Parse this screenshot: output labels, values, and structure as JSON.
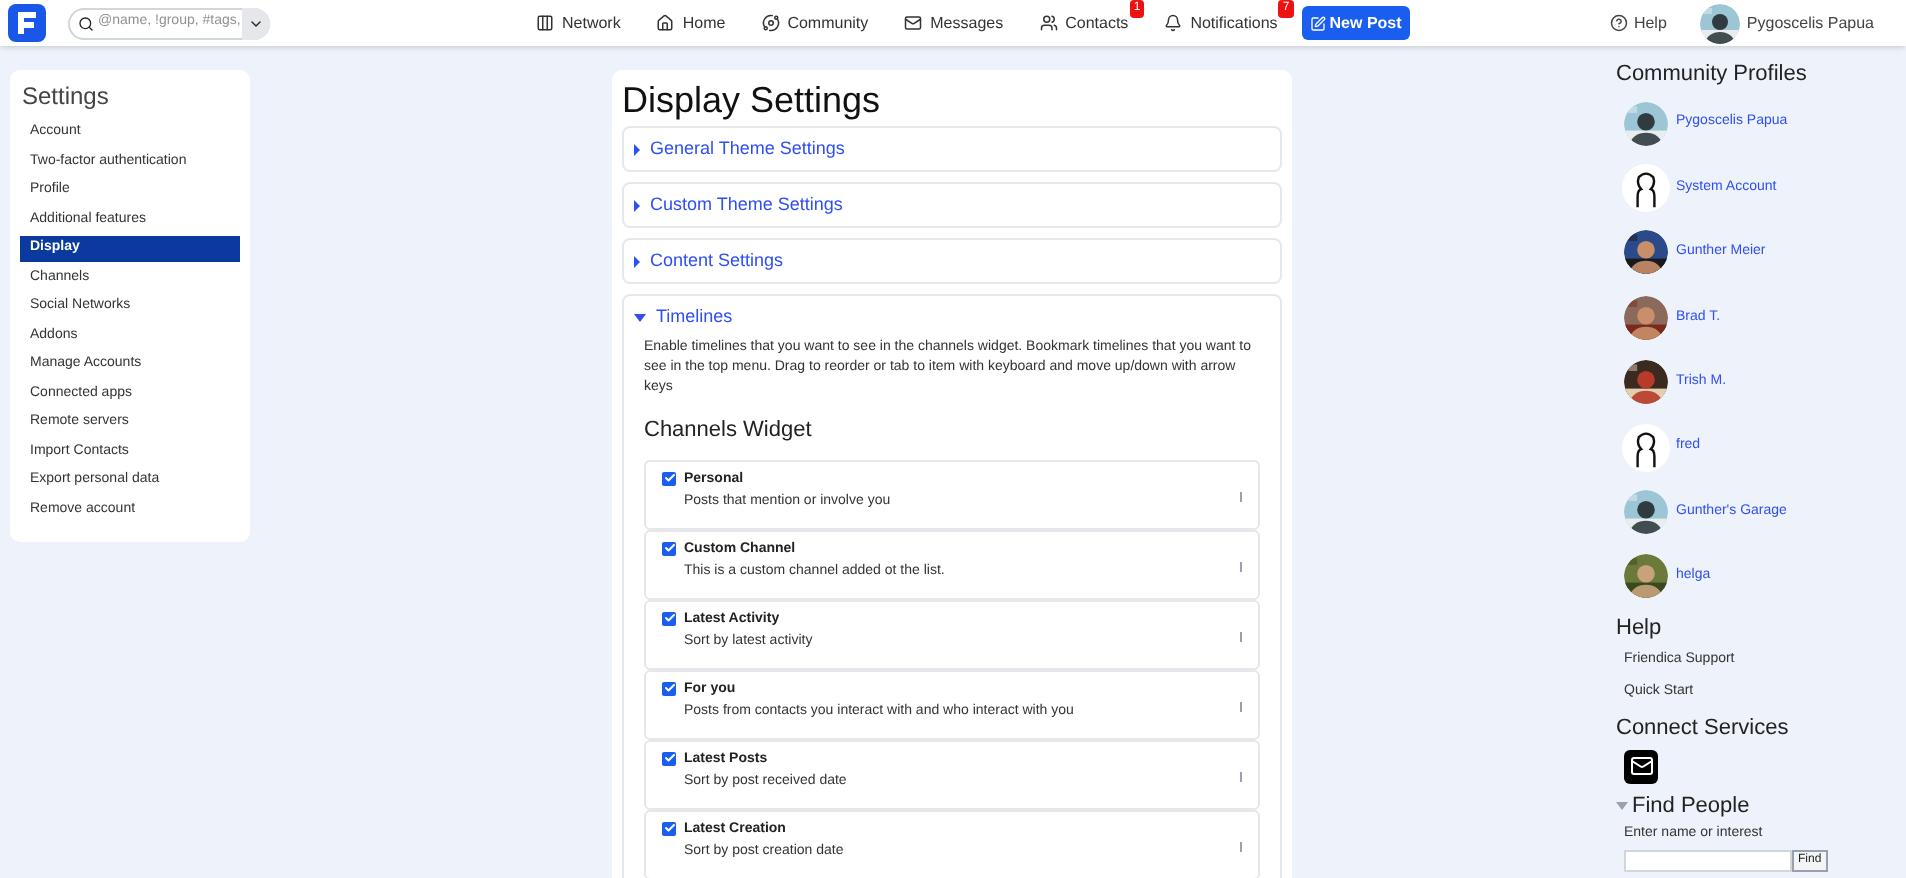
{
  "topbar": {
    "search": {
      "placeholder": "@name, !group, #tags,"
    },
    "nav": [
      {
        "label": "Network"
      },
      {
        "label": "Home"
      },
      {
        "label": "Community"
      },
      {
        "label": "Messages"
      },
      {
        "label": "Contacts",
        "badge": "1"
      },
      {
        "label": "Notifications",
        "badge": "7"
      }
    ],
    "new_post": "New Post",
    "help": "Help",
    "user": "Pygoscelis Papua"
  },
  "sidebar": {
    "title": "Settings",
    "items": [
      {
        "label": "Account",
        "selected": false
      },
      {
        "label": "Two-factor authentication",
        "selected": false
      },
      {
        "label": "Profile",
        "selected": false
      },
      {
        "label": "Additional features",
        "selected": false
      },
      {
        "label": "Display",
        "selected": true
      },
      {
        "label": "Channels",
        "selected": false
      },
      {
        "label": "Social Networks",
        "selected": false
      },
      {
        "label": "Addons",
        "selected": false
      },
      {
        "label": "Manage Accounts",
        "selected": false
      },
      {
        "label": "Connected apps",
        "selected": false
      },
      {
        "label": "Remote servers",
        "selected": false
      },
      {
        "label": "Import Contacts",
        "selected": false
      },
      {
        "label": "Export personal data",
        "selected": false
      },
      {
        "label": "Remove account",
        "selected": false
      }
    ]
  },
  "main": {
    "title": "Display Settings",
    "sections": [
      {
        "label": "General Theme Settings",
        "expanded": false
      },
      {
        "label": "Custom Theme Settings",
        "expanded": false
      },
      {
        "label": "Content Settings",
        "expanded": false
      },
      {
        "label": "Timelines",
        "expanded": true
      }
    ],
    "intro": "Enable timelines that you want to see in the channels widget. Bookmark timelines that you want to see in the top menu. Drag to reorder or tab to item with keyboard and move up/down with arrow keys",
    "widget_title": "Channels Widget",
    "channels": [
      {
        "name": "Personal",
        "description": "Posts that mention or involve you",
        "checked": true
      },
      {
        "name": "Custom Channel",
        "description": "This is a custom channel added ot the list.",
        "checked": true
      },
      {
        "name": "Latest Activity",
        "description": "Sort by latest activity",
        "checked": true
      },
      {
        "name": "For you",
        "description": "Posts from contacts you interact with and who interact with you",
        "checked": true
      },
      {
        "name": "Latest Posts",
        "description": "Sort by post received date",
        "checked": true
      },
      {
        "name": "Latest Creation",
        "description": "Sort by post creation date",
        "checked": true
      }
    ]
  },
  "right": {
    "profiles_title": "Community Profiles",
    "profiles": [
      {
        "name": "Pygoscelis Papua",
        "kind": "picture"
      },
      {
        "name": "System Account",
        "kind": "silhouette"
      },
      {
        "name": "Gunther Meier",
        "kind": "picture"
      },
      {
        "name": "Brad T.",
        "kind": "picture"
      },
      {
        "name": "Trish M.",
        "kind": "picture"
      },
      {
        "name": "fred",
        "kind": "silhouette"
      },
      {
        "name": "Gunther's Garage",
        "kind": "picture"
      },
      {
        "name": "helga",
        "kind": "picture"
      }
    ],
    "help_title": "Help",
    "help_links": [
      "Friendica Support",
      "Quick Start"
    ],
    "connect_title": "Connect Services",
    "find_title": "Find People",
    "find_label": "Enter name or interest",
    "find_button": "Find"
  }
}
